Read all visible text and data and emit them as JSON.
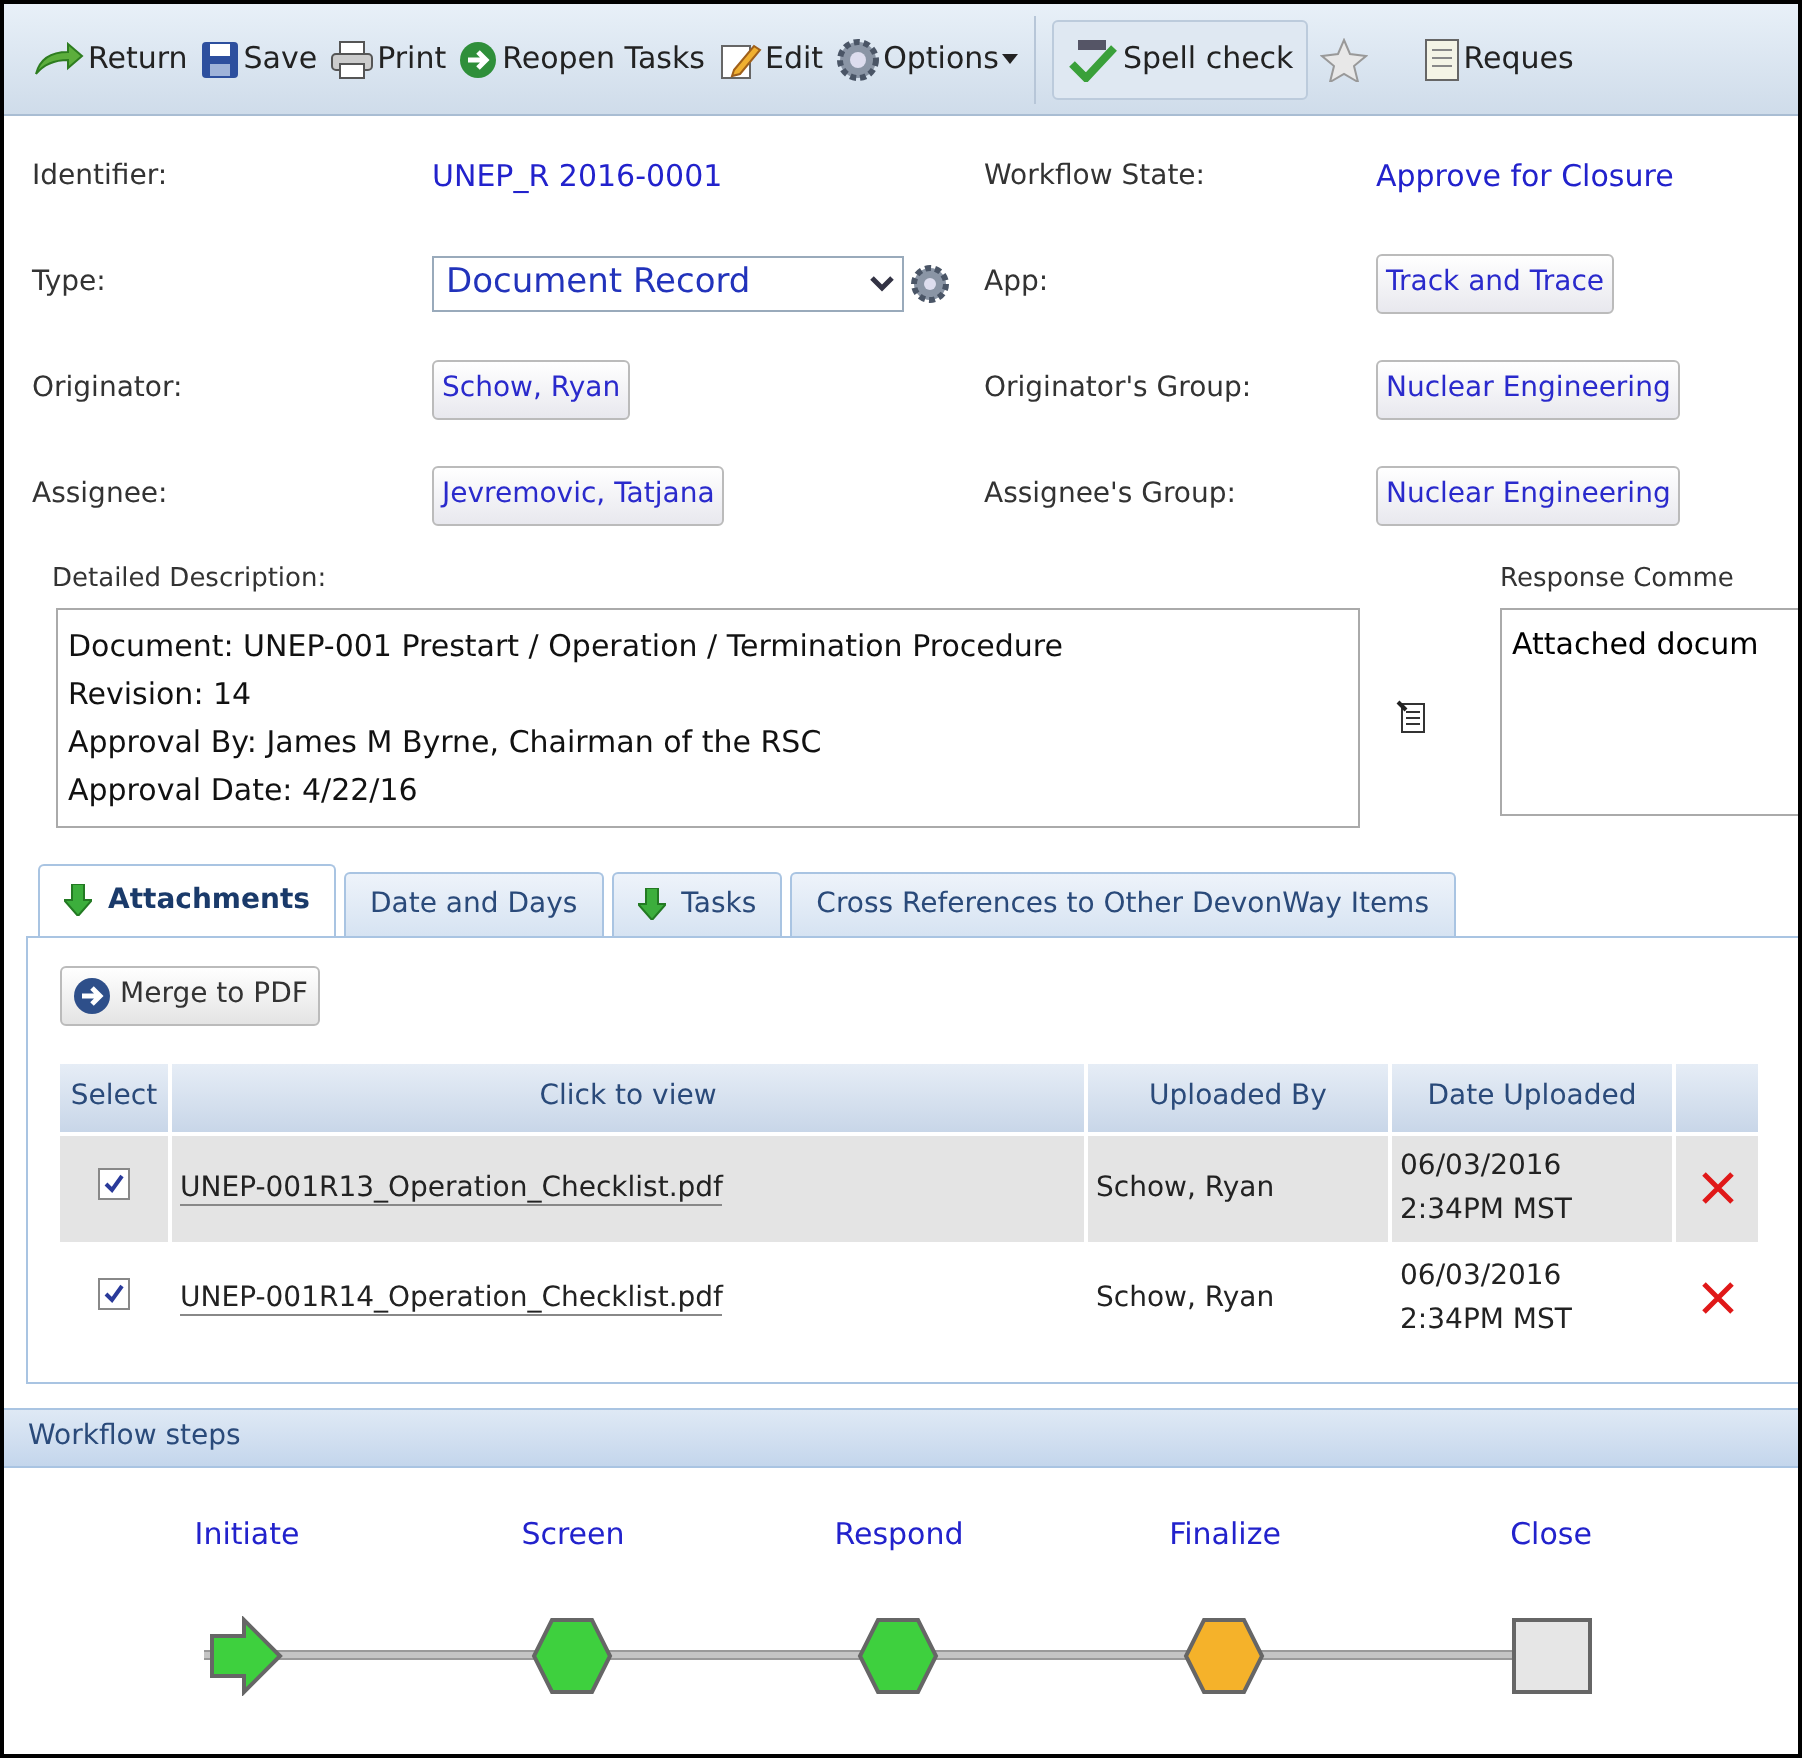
{
  "toolbar": [
    {
      "kind": "return",
      "label": "Return"
    },
    {
      "kind": "save",
      "label": "Save"
    },
    {
      "kind": "print",
      "label": "Print"
    },
    {
      "kind": "reopen",
      "label": "Reopen Tasks"
    },
    {
      "kind": "edit",
      "label": "Edit"
    },
    {
      "kind": "options",
      "label": "Options"
    },
    {
      "kind": "spell",
      "label": "Spell check"
    },
    {
      "kind": "star"
    },
    {
      "kind": "request",
      "label": "Reques"
    }
  ],
  "fields": [
    {
      "label": "Identifier:",
      "kind": "link",
      "value": "UNEP_R 2016-0001"
    },
    {
      "label": "Workflow State:",
      "kind": "link",
      "value": "Approve for Closure"
    },
    {
      "label": "Type:",
      "kind": "select",
      "value": "Document Record"
    },
    {
      "label": "App:",
      "kind": "button",
      "value": "Track and Trace"
    },
    {
      "label": "Originator:",
      "kind": "button",
      "value": "Schow, Ryan"
    },
    {
      "label": "Originator's Group:",
      "kind": "button",
      "value": "Nuclear Engineering"
    },
    {
      "label": "Assignee:",
      "kind": "button",
      "value": "Jevremovic, Tatjana"
    },
    {
      "label": "Assignee's Group:",
      "kind": "button",
      "value": "Nuclear Engineering"
    }
  ],
  "description": {
    "label": "Detailed Description:",
    "lines": [
      "Document: UNEP-001 Prestart / Operation / Termination Procedure",
      "Revision: 14",
      "Approval By: James M Byrne, Chairman of the RSC",
      "Approval Date: 4/22/16"
    ]
  },
  "response": {
    "label": "Response Comme",
    "value": "Attached docum"
  },
  "tabs": [
    {
      "label": "Attachments",
      "icon": true,
      "selected": true
    },
    {
      "label": "Date and Days",
      "icon": false,
      "selected": false
    },
    {
      "label": "Tasks",
      "icon": true,
      "selected": false
    },
    {
      "label": "Cross References to Other DevonWay Items",
      "icon": false,
      "selected": false
    }
  ],
  "merge_button": "Merge to PDF",
  "table": {
    "columns": [
      "Select",
      "Click to view",
      "Uploaded By",
      "Date Uploaded"
    ],
    "rows": [
      {
        "checked": true,
        "selected": true,
        "file": "UNEP-001R13_Operation_Checklist.pdf",
        "uploaded_by": "Schow, Ryan",
        "date": "06/03/2016",
        "time": "2:34PM MST"
      },
      {
        "checked": true,
        "selected": false,
        "file": "UNEP-001R14_Operation_Checklist.pdf",
        "uploaded_by": "Schow, Ryan",
        "date": "06/03/2016",
        "time": "2:34PM MST"
      }
    ]
  },
  "workflow": {
    "title": "Workflow steps",
    "steps": [
      {
        "label": "Initiate",
        "kind": "start",
        "color": "#3ed03e"
      },
      {
        "label": "Screen",
        "kind": "step",
        "color": "#3ed03e"
      },
      {
        "label": "Respond",
        "kind": "step",
        "color": "#3ed03e"
      },
      {
        "label": "Finalize",
        "kind": "step",
        "color": "#f5b22a"
      },
      {
        "label": "Close",
        "kind": "end",
        "color": "#e6e6e6"
      }
    ]
  }
}
